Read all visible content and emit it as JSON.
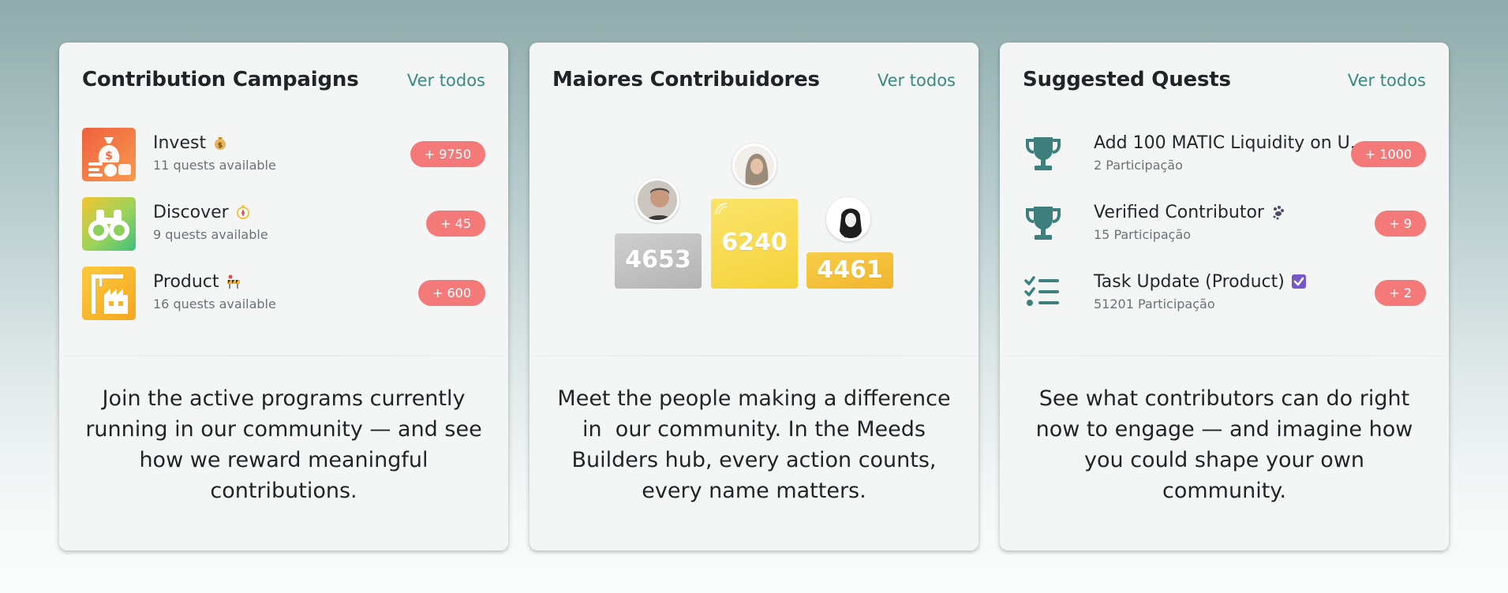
{
  "campaigns": {
    "title": "Contribution Campaigns",
    "ver_todos": "Ver todos",
    "items": [
      {
        "name": "Invest",
        "sub": "11 quests available",
        "points": "+ 9750",
        "emoji_icon": "money-bag-icon"
      },
      {
        "name": "Discover",
        "sub": "9 quests available",
        "points": "+ 45",
        "emoji_icon": "compass-icon"
      },
      {
        "name": "Product",
        "sub": "16 quests available",
        "points": "+ 600",
        "emoji_icon": "construction-icon"
      }
    ],
    "description": "Join the active programs currently running in our community — and see how we reward meaningful contributions."
  },
  "contributors": {
    "title": "Maiores Contribuidores",
    "ver_todos": "Ver todos",
    "podium": {
      "first": "6240",
      "second": "4653",
      "third": "4461"
    },
    "description": "Meet the people making a difference in  our community. In the Meeds Builders hub, every action counts, every name matters."
  },
  "quests": {
    "title": "Suggested Quests",
    "ver_todos": "Ver todos",
    "items": [
      {
        "name": "Add 100 MATIC Liquidity on U...",
        "sub": "2 Participação",
        "points": "+ 1000",
        "icon": "trophy-icon"
      },
      {
        "name": "Verified Contributor",
        "sub": "15 Participação",
        "points": "+ 9",
        "icon": "trophy-icon",
        "emoji_icon": "paw-prints-icon"
      },
      {
        "name": "Task Update (Product)",
        "sub": "51201 Participação",
        "points": "+ 2",
        "icon": "task-list-icon",
        "emoji_icon": "check-box-icon"
      }
    ],
    "description": "See what contributors can do right now to engage — and imagine how you could shape your own community."
  },
  "colors": {
    "accent_link": "#3a8a80",
    "points_pill": "#f47a7a",
    "quest_icon": "#3d7f7c",
    "podium_gold": "#f6d84a",
    "podium_silver": "#bdbdbd",
    "podium_bronze": "#f3c13a"
  }
}
